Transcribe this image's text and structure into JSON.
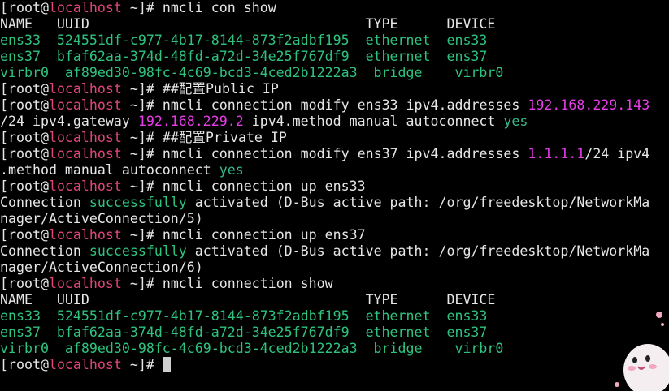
{
  "colors": {
    "background": "#000000",
    "text": "#e6e6e6",
    "green": "#2ec27e",
    "teal": "#35b88a",
    "magenta": "#e83ce8",
    "hostname": "#e0457b"
  },
  "lines": [
    [
      {
        "t": "[root@",
        "c": "plain"
      },
      {
        "t": "localhost",
        "c": "host"
      },
      {
        "t": " ~]# nmcli con show",
        "c": "plain"
      }
    ],
    [
      {
        "t": "NAME   UUID                                  TYPE      DEVICE",
        "c": "plain"
      }
    ],
    [
      {
        "t": "ens33  524551df-c977-4b17-8144-873f2adbf195  ethernet  ens33",
        "c": "green"
      }
    ],
    [
      {
        "t": "ens37  bfaf62aa-374d-48fd-a72d-34e25f767df9  ethernet  ens37",
        "c": "green"
      }
    ],
    [
      {
        "t": "virbr0  af89ed30-98fc-4c69-bcd3-4ced2b1222a3  bridge    virbr0",
        "c": "green"
      }
    ],
    [
      {
        "t": "[root@",
        "c": "plain"
      },
      {
        "t": "localhost",
        "c": "host"
      },
      {
        "t": " ~]# ##配置Public IP",
        "c": "plain"
      }
    ],
    [
      {
        "t": "[root@",
        "c": "plain"
      },
      {
        "t": "localhost",
        "c": "host"
      },
      {
        "t": " ~]# nmcli connection modify ens33 ipv4.addresses ",
        "c": "plain"
      },
      {
        "t": "192.168.229.143",
        "c": "magenta"
      }
    ],
    [
      {
        "t": "/24 ipv4.gateway ",
        "c": "plain"
      },
      {
        "t": "192.168.229.2",
        "c": "magenta"
      },
      {
        "t": " ipv4.method manual autoconnect ",
        "c": "plain"
      },
      {
        "t": "yes",
        "c": "teal"
      }
    ],
    [
      {
        "t": "[root@",
        "c": "plain"
      },
      {
        "t": "localhost",
        "c": "host"
      },
      {
        "t": " ~]# ##配置Private IP",
        "c": "plain"
      }
    ],
    [
      {
        "t": "[root@",
        "c": "plain"
      },
      {
        "t": "localhost",
        "c": "host"
      },
      {
        "t": " ~]# nmcli connection modify ens37 ipv4.addresses ",
        "c": "plain"
      },
      {
        "t": "1.1.1.1",
        "c": "magenta"
      },
      {
        "t": "/24 ipv4",
        "c": "plain"
      }
    ],
    [
      {
        "t": ".method manual autoconnect ",
        "c": "plain"
      },
      {
        "t": "yes",
        "c": "teal"
      }
    ],
    [
      {
        "t": "[root@",
        "c": "plain"
      },
      {
        "t": "localhost",
        "c": "host"
      },
      {
        "t": " ~]# nmcli connection up ens33",
        "c": "plain"
      }
    ],
    [
      {
        "t": "Connection ",
        "c": "plain"
      },
      {
        "t": "successfully",
        "c": "green"
      },
      {
        "t": " activated (D-Bus active path: /org/freedesktop/NetworkMa",
        "c": "plain"
      }
    ],
    [
      {
        "t": "nager/ActiveConnection/5)",
        "c": "plain"
      }
    ],
    [
      {
        "t": "[root@",
        "c": "plain"
      },
      {
        "t": "localhost",
        "c": "host"
      },
      {
        "t": " ~]# nmcli connection up ens37",
        "c": "plain"
      }
    ],
    [
      {
        "t": "Connection ",
        "c": "plain"
      },
      {
        "t": "successfully",
        "c": "green"
      },
      {
        "t": " activated (D-Bus active path: /org/freedesktop/NetworkMa",
        "c": "plain"
      }
    ],
    [
      {
        "t": "nager/ActiveConnection/6)",
        "c": "plain"
      }
    ],
    [
      {
        "t": "[root@",
        "c": "plain"
      },
      {
        "t": "localhost",
        "c": "host"
      },
      {
        "t": " ~]# nmcli connection show",
        "c": "plain"
      }
    ],
    [
      {
        "t": "NAME   UUID                                  TYPE      DEVICE",
        "c": "plain"
      }
    ],
    [
      {
        "t": "ens33  524551df-c977-4b17-8144-873f2adbf195  ethernet  ens33",
        "c": "green"
      }
    ],
    [
      {
        "t": "ens37  bfaf62aa-374d-48fd-a72d-34e25f767df9  ethernet  ens37",
        "c": "green"
      }
    ],
    [
      {
        "t": "virbr0  af89ed30-98fc-4c69-bcd3-4ced2b1222a3  bridge    virbr0",
        "c": "green"
      }
    ],
    [
      {
        "t": "[root@",
        "c": "plain"
      },
      {
        "t": "localhost",
        "c": "host"
      },
      {
        "t": " ~]# ",
        "c": "plain"
      }
    ]
  ],
  "cursor": {
    "shown": true
  },
  "mascot_icon": "cartoon-mascot-icon"
}
